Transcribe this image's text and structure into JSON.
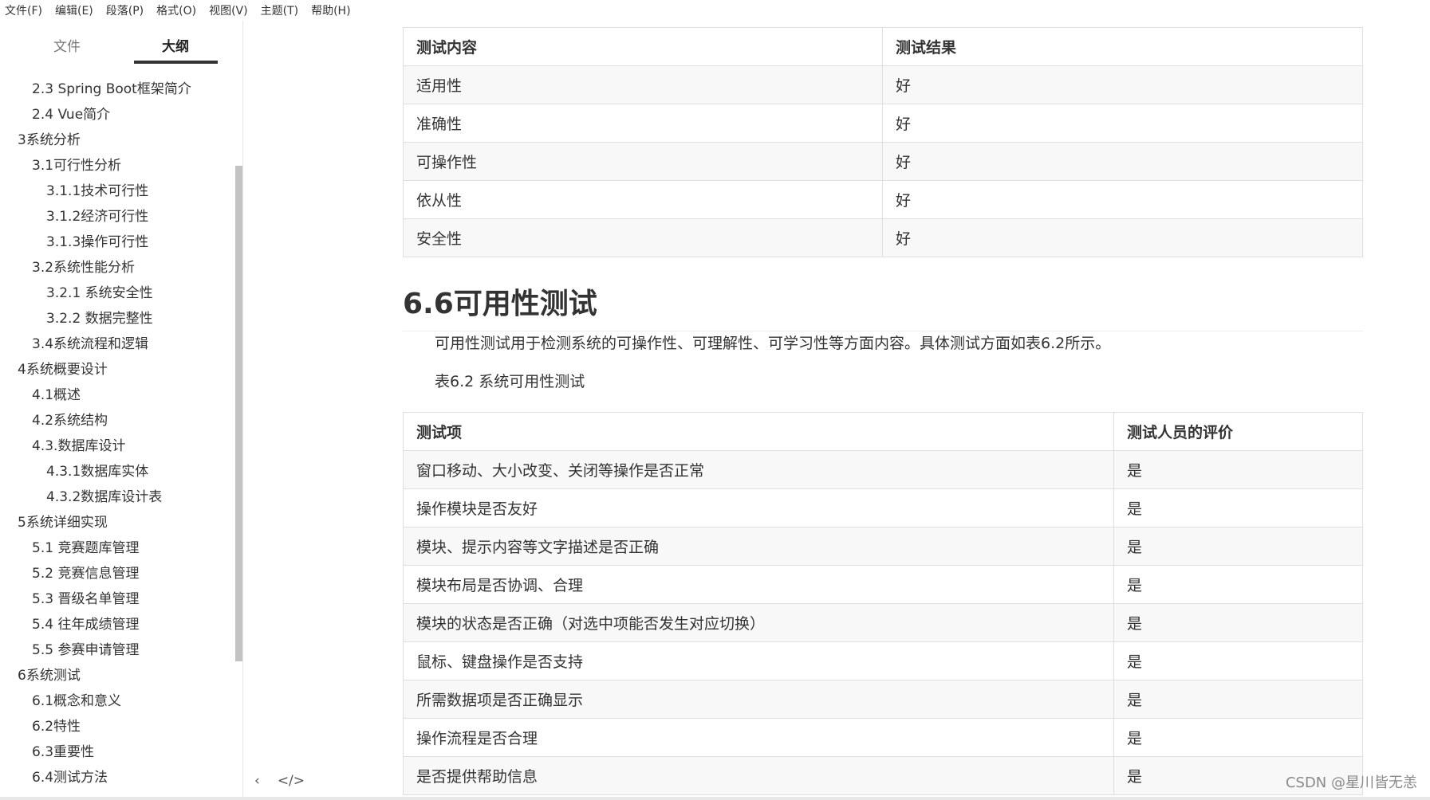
{
  "menu": [
    "文件(F)",
    "编辑(E)",
    "段落(P)",
    "格式(O)",
    "视图(V)",
    "主题(T)",
    "帮助(H)"
  ],
  "sidebar": {
    "tabs": {
      "files": "文件",
      "outline": "大纲"
    },
    "outline": [
      {
        "label": "2.3 Spring Boot框架简介",
        "level": 2
      },
      {
        "label": "2.4 Vue简介",
        "level": 2
      },
      {
        "label": "3系统分析",
        "level": 1
      },
      {
        "label": "3.1可行性分析",
        "level": 2
      },
      {
        "label": "3.1.1技术可行性",
        "level": 3
      },
      {
        "label": "3.1.2经济可行性",
        "level": 3
      },
      {
        "label": "3.1.3操作可行性",
        "level": 3
      },
      {
        "label": "3.2系统性能分析",
        "level": 2
      },
      {
        "label": "3.2.1 系统安全性",
        "level": 3
      },
      {
        "label": "3.2.2 数据完整性",
        "level": 3
      },
      {
        "label": "3.4系统流程和逻辑",
        "level": 2
      },
      {
        "label": "4系统概要设计",
        "level": 1
      },
      {
        "label": "4.1概述",
        "level": 2
      },
      {
        "label": "4.2系统结构",
        "level": 2
      },
      {
        "label": "4.3.数据库设计",
        "level": 2
      },
      {
        "label": "4.3.1数据库实体",
        "level": 3
      },
      {
        "label": "4.3.2数据库设计表",
        "level": 3
      },
      {
        "label": "5系统详细实现",
        "level": 1
      },
      {
        "label": "5.1 竞赛题库管理",
        "level": 2
      },
      {
        "label": "5.2 竞赛信息管理",
        "level": 2
      },
      {
        "label": "5.3 晋级名单管理",
        "level": 2
      },
      {
        "label": "5.4 往年成绩管理",
        "level": 2
      },
      {
        "label": "5.5 参赛申请管理",
        "level": 2
      },
      {
        "label": "6系统测试",
        "level": 1
      },
      {
        "label": "6.1概念和意义",
        "level": 2
      },
      {
        "label": "6.2特性",
        "level": 2
      },
      {
        "label": "6.3重要性",
        "level": 2
      },
      {
        "label": "6.4测试方法",
        "level": 2
      }
    ],
    "footer": {
      "back_icon": "‹",
      "code_icon": "</>"
    }
  },
  "table1": {
    "headers": [
      "测试内容",
      "测试结果"
    ],
    "rows": [
      [
        "适用性",
        "好"
      ],
      [
        "准确性",
        "好"
      ],
      [
        "可操作性",
        "好"
      ],
      [
        "依从性",
        "好"
      ],
      [
        "安全性",
        "好"
      ]
    ]
  },
  "section": {
    "heading": "6.6可用性测试",
    "paragraph": "可用性测试用于检测系统的可操作性、可理解性、可学习性等方面内容。具体测试方面如表6.2所示。",
    "caption": "表6.2 系统可用性测试"
  },
  "table2": {
    "headers": [
      "测试项",
      "测试人员的评价"
    ],
    "rows": [
      [
        "窗口移动、大小改变、关闭等操作是否正常",
        "是"
      ],
      [
        "操作模块是否友好",
        "是"
      ],
      [
        "模块、提示内容等文字描述是否正确",
        "是"
      ],
      [
        "模块布局是否协调、合理",
        "是"
      ],
      [
        "模块的状态是否正确（对选中项能否发生对应切换）",
        "是"
      ],
      [
        "鼠标、键盘操作是否支持",
        "是"
      ],
      [
        "所需数据项是否正确显示",
        "是"
      ],
      [
        "操作流程是否合理",
        "是"
      ],
      [
        "是否提供帮助信息",
        "是"
      ]
    ]
  },
  "watermark": "CSDN @星川皆无恙"
}
